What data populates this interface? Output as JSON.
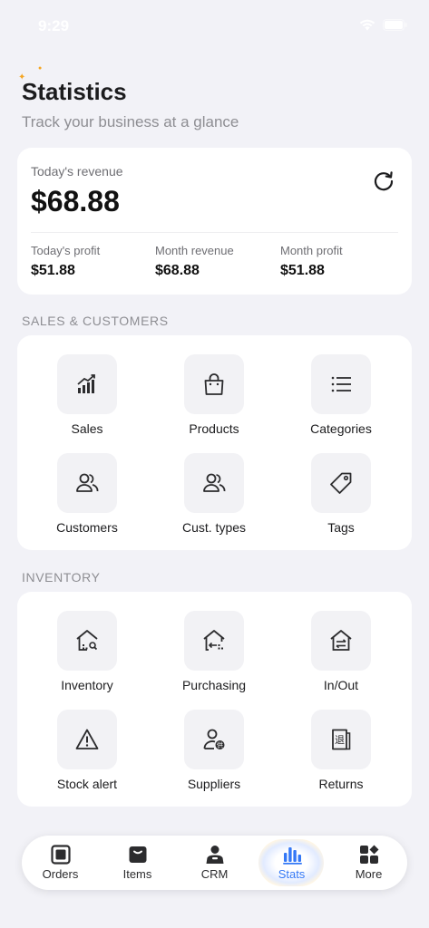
{
  "status_bar": {
    "time": "9:29"
  },
  "header": {
    "title": "Statistics",
    "subtitle": "Track your business at a glance"
  },
  "revenue": {
    "label": "Today's revenue",
    "value": "$68.88",
    "metrics": [
      {
        "label": "Today's profit",
        "value": "$51.88"
      },
      {
        "label": "Month revenue",
        "value": "$68.88"
      },
      {
        "label": "Month profit",
        "value": "$51.88"
      }
    ]
  },
  "sales_section": {
    "title": "SALES & CUSTOMERS",
    "items": [
      {
        "label": "Sales",
        "icon": "sales-chart-icon"
      },
      {
        "label": "Products",
        "icon": "shopping-bag-icon"
      },
      {
        "label": "Categories",
        "icon": "list-icon"
      },
      {
        "label": "Customers",
        "icon": "people-icon"
      },
      {
        "label": "Cust. types",
        "icon": "people-group-icon"
      },
      {
        "label": "Tags",
        "icon": "tag-icon"
      }
    ]
  },
  "inventory_section": {
    "title": "INVENTORY",
    "items": [
      {
        "label": "Inventory",
        "icon": "warehouse-search-icon"
      },
      {
        "label": "Purchasing",
        "icon": "warehouse-in-icon"
      },
      {
        "label": "In/Out",
        "icon": "transfer-house-icon"
      },
      {
        "label": "Stock alert",
        "icon": "warning-icon"
      },
      {
        "label": "Suppliers",
        "icon": "supplier-icon"
      },
      {
        "label": "Returns",
        "icon": "returns-icon"
      }
    ]
  },
  "tab_bar": {
    "tabs": [
      {
        "label": "Orders",
        "icon": "orders-icon"
      },
      {
        "label": "Items",
        "icon": "items-icon"
      },
      {
        "label": "CRM",
        "icon": "crm-icon"
      },
      {
        "label": "Stats",
        "icon": "stats-icon",
        "active": true
      },
      {
        "label": "More",
        "icon": "more-icon"
      }
    ]
  },
  "colors": {
    "background": "#F2F2F7",
    "card": "#FFFFFF",
    "accent": "#3478F6",
    "text": "#1C1C1E",
    "secondary_text": "#8E8E93"
  }
}
